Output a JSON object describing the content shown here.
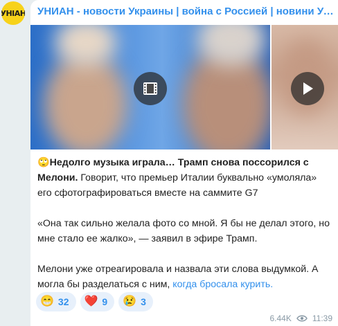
{
  "channel": {
    "avatar_text": "УНІАН",
    "title": "УНИАН - новости Украины | война с Россией | новини України | ..."
  },
  "post": {
    "emoji": "🙄",
    "bold_line": "Недолго музыка играла… Трамп снова поссорился с Мелони.",
    "line1_rest": " Говорит, что премьер Италии буквально «умоляла» его сфотографироваться вместе на саммите G7",
    "para2": "«Она так сильно желала фото со мной. Я бы не делал этого, но мне стало ее жалко», — заявил в эфире Трамп.",
    "para3": "Мелони уже отреагировала и назвала эти слова выдумкой. А могла бы разделаться с ним, ",
    "link_text": "когда бросала курить."
  },
  "reactions": [
    {
      "emoji": "😁",
      "count": "32"
    },
    {
      "emoji": "❤️",
      "count": "9"
    },
    {
      "emoji": "😢",
      "count": "3"
    }
  ],
  "meta": {
    "views": "6.44K",
    "time": "11:39"
  },
  "colors": {
    "accent": "#3390ec",
    "avatar_bg": "#f7d21a"
  }
}
